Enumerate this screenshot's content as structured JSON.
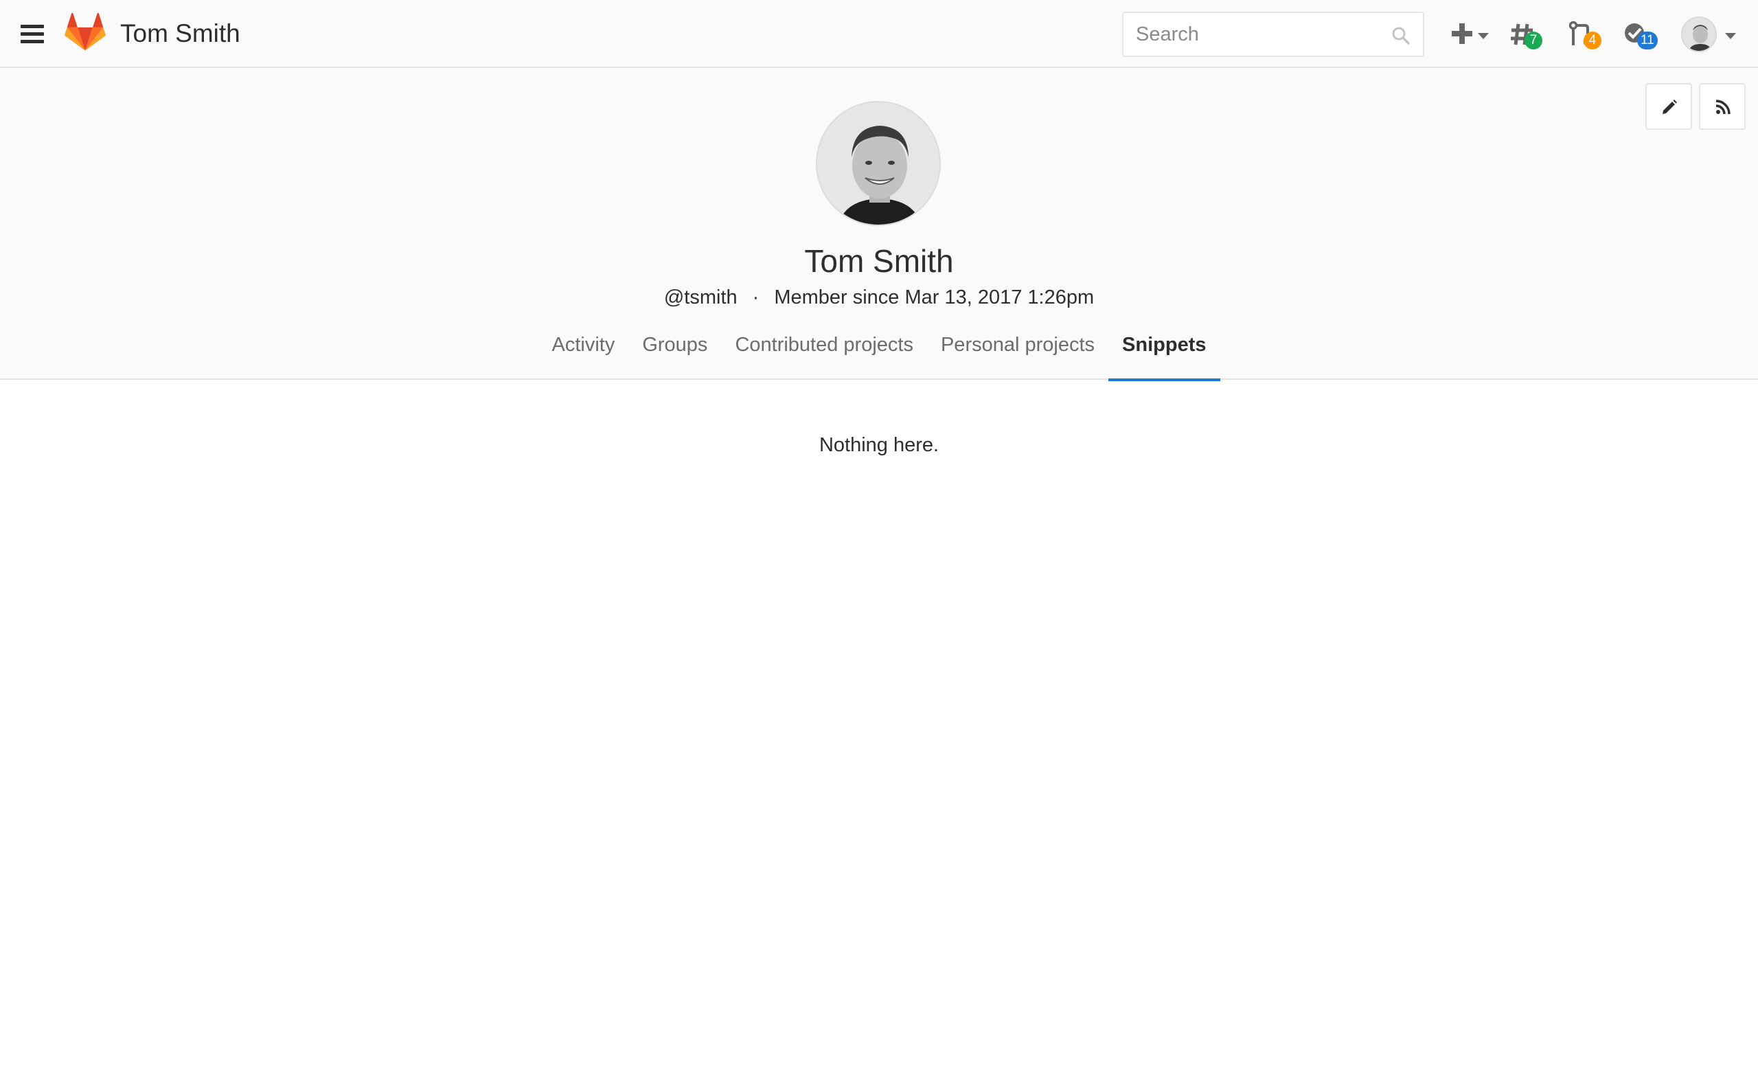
{
  "navbar": {
    "title": "Tom Smith",
    "search_placeholder": "Search",
    "issues_count": "7",
    "merge_requests_count": "4",
    "todos_count": "11",
    "colors": {
      "issues_badge": "#1aaa55",
      "merge_requests_badge": "#fc9403",
      "todos_badge": "#1f78d1"
    }
  },
  "profile": {
    "name": "Tom Smith",
    "username": "@tsmith",
    "separator": "·",
    "member_since": "Member since Mar 13, 2017 1:26pm"
  },
  "tabs": [
    {
      "label": "Activity",
      "active": false
    },
    {
      "label": "Groups",
      "active": false
    },
    {
      "label": "Contributed projects",
      "active": false
    },
    {
      "label": "Personal projects",
      "active": false
    },
    {
      "label": "Snippets",
      "active": true
    }
  ],
  "content": {
    "empty_message": "Nothing here."
  },
  "icons": {
    "menu": "hamburger-icon",
    "logo": "gitlab-logo",
    "search": "search-icon",
    "new": "plus-icon",
    "issues": "issues-icon",
    "merge_requests": "merge-request-icon",
    "todos": "todo-icon",
    "edit": "pencil-icon",
    "rss": "rss-icon"
  }
}
